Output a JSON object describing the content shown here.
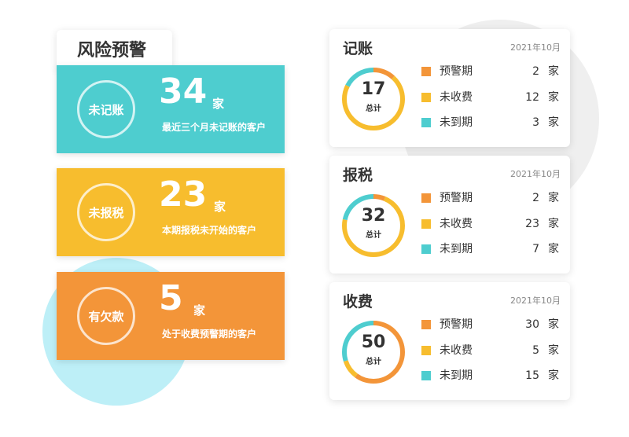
{
  "colors": {
    "teal": "#4ecdcf",
    "yellow": "#f7bd2e",
    "orange": "#f39539"
  },
  "panel_title": "风险预警",
  "risk_cards": [
    {
      "label": "未记账",
      "count": "34",
      "unit": "家",
      "desc": "最近三个月未记账的客户",
      "color": "#4ecdcf"
    },
    {
      "label": "未报税",
      "count": "23",
      "unit": "家",
      "desc": "本期报税未开始的客户",
      "color": "#f7bd2e"
    },
    {
      "label": "有欠款",
      "count": "5",
      "unit": "家",
      "desc": "处于收费预警期的客户",
      "color": "#f39539"
    }
  ],
  "stat_cards": [
    {
      "title": "记账",
      "date": "2021年10月",
      "total": "17",
      "total_label": "总计",
      "items": [
        {
          "name": "预警期",
          "value": 2,
          "unit": "家",
          "color": "#f39539"
        },
        {
          "name": "未收费",
          "value": 12,
          "unit": "家",
          "color": "#f7bd2e"
        },
        {
          "name": "未到期",
          "value": 3,
          "unit": "家",
          "color": "#4ecdcf"
        }
      ]
    },
    {
      "title": "报税",
      "date": "2021年10月",
      "total": "32",
      "total_label": "总计",
      "items": [
        {
          "name": "预警期",
          "value": 2,
          "unit": "家",
          "color": "#f39539"
        },
        {
          "name": "未收费",
          "value": 23,
          "unit": "家",
          "color": "#f7bd2e"
        },
        {
          "name": "未到期",
          "value": 7,
          "unit": "家",
          "color": "#4ecdcf"
        }
      ]
    },
    {
      "title": "收费",
      "date": "2021年10月",
      "total": "50",
      "total_label": "总计",
      "items": [
        {
          "name": "预警期",
          "value": 30,
          "unit": "家",
          "color": "#f39539"
        },
        {
          "name": "未收费",
          "value": 5,
          "unit": "家",
          "color": "#f7bd2e"
        },
        {
          "name": "未到期",
          "value": 15,
          "unit": "家",
          "color": "#4ecdcf"
        }
      ]
    }
  ]
}
